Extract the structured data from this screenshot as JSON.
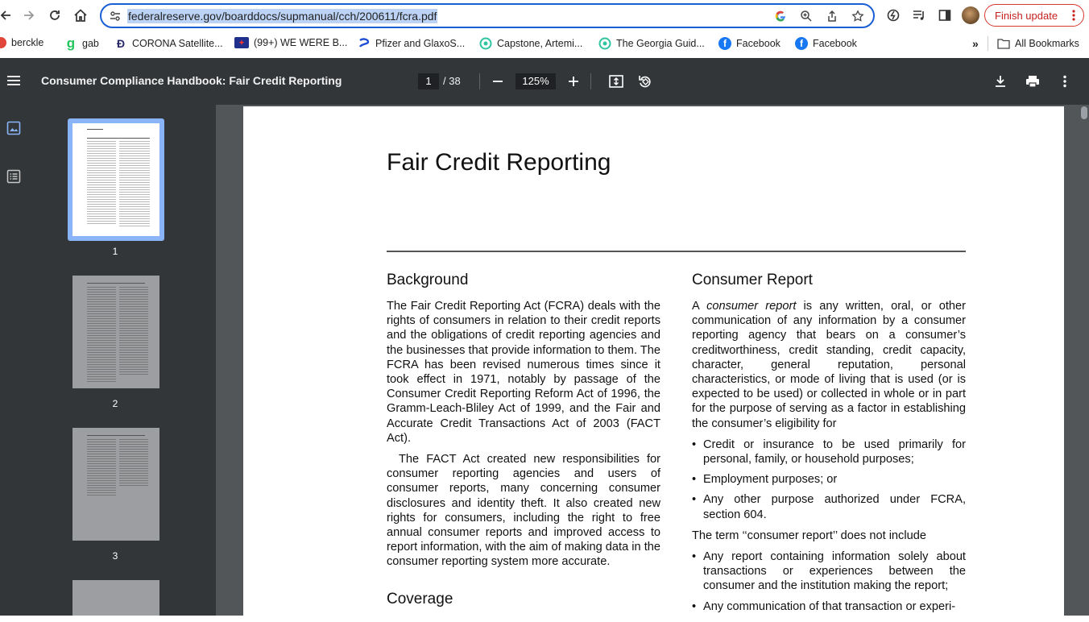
{
  "browser": {
    "url": "federalreserve.gov/boarddocs/supmanual/cch/200611/fcra.pdf",
    "finish_update": "Finish update"
  },
  "bookmarks": [
    {
      "label": "berckle",
      "icon": "berklee-icon"
    },
    {
      "label": "gab",
      "icon": "gab-icon"
    },
    {
      "label": "CORONA Satellite...",
      "icon": "corona-icon"
    },
    {
      "label": "(99+) WE WERE B...",
      "icon": "flag-icon"
    },
    {
      "label": "Pfizer and GlaxoS...",
      "icon": "pfizer-icon"
    },
    {
      "label": "Capstone, Artemi...",
      "icon": "capstone-icon"
    },
    {
      "label": "The Georgia Guid...",
      "icon": "capstone-icon"
    },
    {
      "label": "Facebook",
      "icon": "facebook-icon"
    },
    {
      "label": "Facebook",
      "icon": "facebook-icon"
    }
  ],
  "bookmarks_overflow": "»",
  "all_bookmarks": "All Bookmarks",
  "pdf": {
    "title": "Consumer Compliance Handbook: Fair Credit Reporting",
    "page": "1",
    "total": "/ 38",
    "zoom": "125%"
  },
  "thumbnails": [
    {
      "label": "1",
      "selected": true
    },
    {
      "label": "2",
      "selected": false
    },
    {
      "label": "3",
      "selected": false
    }
  ],
  "document": {
    "title": "Fair Credit Reporting",
    "left": {
      "heading": "Background",
      "p1": "The Fair Credit Reporting Act (FCRA) deals with the rights of consumers in relation to their credit reports and the obligations of credit reporting agencies and the businesses that provide information to them. The FCRA has been revised numerous times since it took effect in 1971, notably by passage of the Consumer Credit Reporting Reform Act of 1996, the Gramm-Leach-Bliley Act of 1999, and the Fair and Accurate Credit Transactions Act of 2003 (FACT Act).",
      "p2": "The FACT Act created new responsibilities for consumer reporting agencies and users of consumer reports, many concerning consumer disclosures and identity theft. It also created new rights for consumers, including the right to free annual consumer reports and improved access to report information, with the aim of making data in the consumer reporting system more accurate.",
      "heading2": "Coverage"
    },
    "right": {
      "heading": "Consumer Report",
      "p1_a": "A ",
      "p1_em": "consumer report",
      "p1_b": " is any written, oral, or other communication of any information by a consumer reporting agency that bears on a consumer’s creditworthiness, credit standing, credit capacity, character, general reputation, personal characteristics, or mode of living that is used (or is expected to be used) or collected in whole or in part for the purpose of serving as a factor in establishing the consumer’s eligibility for",
      "bullets1": [
        "Credit or insurance to be used primarily for personal, family, or household purposes;",
        "Employment purposes; or",
        "Any other purpose authorized under FCRA, section 604."
      ],
      "p2": "The term ‘‘consumer report’’ does not include",
      "bullets2": [
        "Any report containing information solely about transactions or experiences between the consumer and the institution making the report;",
        "Any communication of that transaction or experi-"
      ]
    }
  }
}
